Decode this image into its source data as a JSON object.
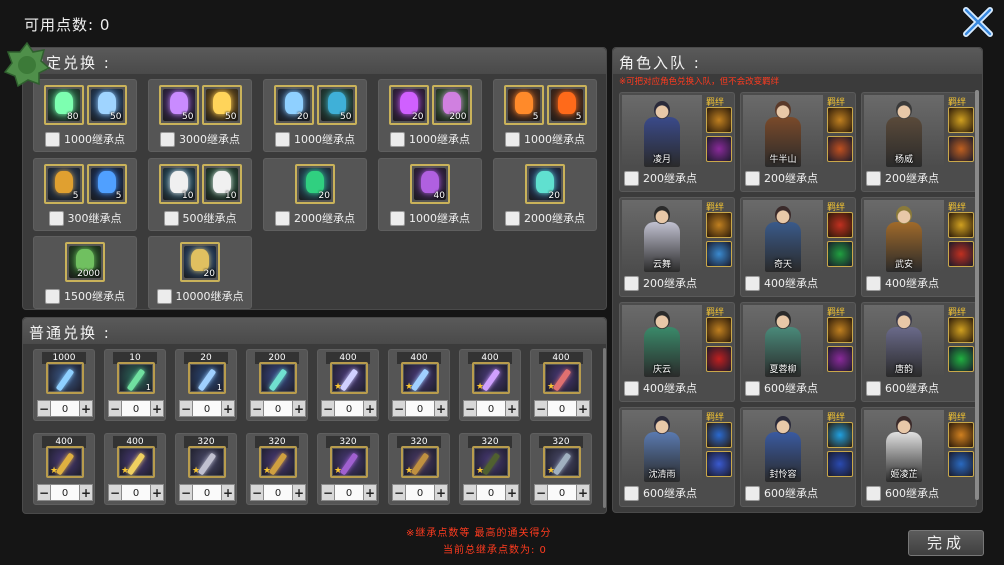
{
  "header": {
    "available_points": "可用点数: 0"
  },
  "limited": {
    "title": "限定兑换 :",
    "items": [
      {
        "cost": "1000继承点",
        "icons": [
          {
            "name": "green-gem-icon",
            "qty": "80",
            "color": "#2e8a5a",
            "shape": "#7dffb0"
          },
          {
            "name": "blue-gem-icon",
            "qty": "50",
            "color": "#2a5c9a",
            "shape": "#9fd4ff"
          }
        ]
      },
      {
        "cost": "3000继承点",
        "icons": [
          {
            "name": "purple-gem-icon",
            "qty": "50",
            "color": "#4c2f7a",
            "shape": "#c98bff"
          },
          {
            "name": "gold-gem-icon",
            "qty": "50",
            "color": "#9a6a1a",
            "shape": "#ffd45a"
          }
        ]
      },
      {
        "cost": "1000继承点",
        "icons": [
          {
            "name": "blue-crystal-icon",
            "qty": "20",
            "color": "#2d4d7a",
            "shape": "#8fd0ff"
          },
          {
            "name": "green-crystal-icon",
            "qty": "50",
            "color": "#2a6a5a",
            "shape": "#3fb0d8"
          }
        ]
      },
      {
        "cost": "1000继承点",
        "icons": [
          {
            "name": "purple-flame-icon",
            "qty": "20",
            "color": "#5a2a7a",
            "shape": "#d060ff"
          },
          {
            "name": "purple-powder-icon",
            "qty": "200",
            "color": "#4a8a4a",
            "shape": "#d080e0"
          }
        ]
      },
      {
        "cost": "1000继承点",
        "icons": [
          {
            "name": "fire-orb-icon",
            "qty": "5",
            "color": "#7a3a1a",
            "shape": "#ff8a2a"
          },
          {
            "name": "fire-orb-icon",
            "qty": "5",
            "color": "#7a3a1a",
            "shape": "#ff6a1a"
          }
        ]
      },
      {
        "cost": "300继承点",
        "icons": [
          {
            "name": "gold-scroll-icon",
            "qty": "5",
            "color": "#2a4a7a",
            "shape": "#e0a030"
          },
          {
            "name": "blue-scroll-icon",
            "qty": "5",
            "color": "#1a3a7a",
            "shape": "#50a0ff"
          }
        ]
      },
      {
        "cost": "500继承点",
        "icons": [
          {
            "name": "gourd-icon",
            "qty": "10",
            "color": "#2a6a8a",
            "shape": "#f0f0f0"
          },
          {
            "name": "gourd-icon",
            "qty": "10",
            "color": "#2a6a4a",
            "shape": "#f0f0f0"
          }
        ]
      },
      {
        "cost": "2000继承点",
        "icons": [
          {
            "name": "green-jade-icon",
            "qty": "20",
            "color": "#2a6a8a",
            "shape": "#30d080"
          }
        ]
      },
      {
        "cost": "1000继承点",
        "icons": [
          {
            "name": "purple-orb-icon",
            "qty": "40",
            "color": "#4a2a6a",
            "shape": "#b060e0"
          }
        ]
      },
      {
        "cost": "2000继承点",
        "icons": [
          {
            "name": "cyan-orb-icon",
            "qty": "20",
            "color": "#2a4a8a",
            "shape": "#60e0d0"
          }
        ]
      },
      {
        "cost": "1500继承点",
        "icons": [
          {
            "name": "green-frog-icon",
            "qty": "2000",
            "color": "#2a6a2a",
            "shape": "#70c060"
          }
        ]
      },
      {
        "cost": "10000继承点",
        "icons": [
          {
            "name": "sword-fragment-icon",
            "qty": "20",
            "color": "#2a5a9a",
            "shape": "#e0c060"
          }
        ]
      }
    ]
  },
  "normal": {
    "title": "普通兑换 :",
    "items": [
      {
        "price": "1000",
        "name": "blue-sword-icon",
        "bg": "#3a5a8a",
        "blade": "#8fd0ff",
        "star": false,
        "count": ""
      },
      {
        "price": "10",
        "name": "green-gem-icon",
        "bg": "#2a6a5a",
        "blade": "#70e0a0",
        "star": false,
        "count": "1"
      },
      {
        "price": "20",
        "name": "blue-gem-icon",
        "bg": "#2a4a7a",
        "blade": "#9fd0ff",
        "star": false,
        "count": "1"
      },
      {
        "price": "200",
        "name": "cyan-orb-icon",
        "bg": "#3a4a8a",
        "blade": "#70e0d0",
        "star": false,
        "count": ""
      },
      {
        "price": "400",
        "name": "purple-sword-icon",
        "bg": "#4a3a7a",
        "blade": "#d0d0ff",
        "star": true,
        "count": ""
      },
      {
        "price": "400",
        "name": "blue-spear-icon",
        "bg": "#4a3a7a",
        "blade": "#a0d0ff",
        "star": true,
        "count": ""
      },
      {
        "price": "400",
        "name": "purple-dagger-icon",
        "bg": "#4a3a7a",
        "blade": "#d0a0ff",
        "star": true,
        "count": ""
      },
      {
        "price": "400",
        "name": "red-axe-icon",
        "bg": "#4a3a7a",
        "blade": "#e07070",
        "star": true,
        "count": ""
      },
      {
        "price": "400",
        "name": "gold-bow-icon",
        "bg": "#4a3a7a",
        "blade": "#e0b040",
        "star": true,
        "count": ""
      },
      {
        "price": "400",
        "name": "gold-staff-icon",
        "bg": "#4a3a7a",
        "blade": "#f0d060",
        "star": true,
        "count": ""
      },
      {
        "price": "320",
        "name": "silver-armor-icon",
        "bg": "#4a4a6a",
        "blade": "#c0c0d0",
        "star": true,
        "count": ""
      },
      {
        "price": "320",
        "name": "gold-blade-icon",
        "bg": "#4a3a7a",
        "blade": "#d0a040",
        "star": true,
        "count": ""
      },
      {
        "price": "320",
        "name": "purple-glove-icon",
        "bg": "#4a3a7a",
        "blade": "#a060d0",
        "star": true,
        "count": ""
      },
      {
        "price": "320",
        "name": "gold-armor-icon",
        "bg": "#4a3a6a",
        "blade": "#c09040",
        "star": true,
        "count": ""
      },
      {
        "price": "320",
        "name": "dark-robe-icon",
        "bg": "#4a3a7a",
        "blade": "#506030",
        "star": true,
        "count": ""
      },
      {
        "price": "320",
        "name": "steel-armor-icon",
        "bg": "#4a4a6a",
        "blade": "#a0b0c0",
        "star": true,
        "count": ""
      }
    ],
    "stepper_value": "0",
    "minus": "−",
    "plus": "+"
  },
  "team": {
    "title": "角色入队 :",
    "note": "※可把对应角色兑换入队，但不会改变羁绊",
    "bond_label": "羁绊",
    "characters": [
      {
        "name": "凌月",
        "cost": "200继承点",
        "hair": "#2a2a3a",
        "robe": "#3a4a8a",
        "s1": "#c08020",
        "s2": "#8a2a9a"
      },
      {
        "name": "牛半山",
        "cost": "200继承点",
        "hair": "#5a3a2a",
        "robe": "#7a4a2a",
        "s1": "#c08020",
        "s2": "#c05020"
      },
      {
        "name": "杨威",
        "cost": "200继承点",
        "hair": "#3a3a3a",
        "robe": "#5a4a3a",
        "s1": "#d0a020",
        "s2": "#c06020"
      },
      {
        "name": "云舞",
        "cost": "200继承点",
        "hair": "#2a2a2a",
        "robe": "#c0c0d0",
        "s1": "#c08020",
        "s2": "#3a8ad0"
      },
      {
        "name": "奇天",
        "cost": "400继承点",
        "hair": "#3a2a2a",
        "robe": "#3a5a8a",
        "s1": "#c03020",
        "s2": "#20a040"
      },
      {
        "name": "武安",
        "cost": "400继承点",
        "hair": "#8a7a3a",
        "robe": "#a06a2a",
        "s1": "#d0a020",
        "s2": "#c03020"
      },
      {
        "name": "庆云",
        "cost": "400继承点",
        "hair": "#2a2a2a",
        "robe": "#3a8a6a",
        "s1": "#c08020",
        "s2": "#c02020"
      },
      {
        "name": "夏蓉柳",
        "cost": "600继承点",
        "hair": "#2a2a2a",
        "robe": "#4a8a7a",
        "s1": "#c08020",
        "s2": "#8a2a9a"
      },
      {
        "name": "唐韵",
        "cost": "600继承点",
        "hair": "#3a3a4a",
        "robe": "#6a6a8a",
        "s1": "#d0a020",
        "s2": "#20b040"
      },
      {
        "name": "沈清雨",
        "cost": "600继承点",
        "hair": "#2a2a3a",
        "robe": "#5a7ab0",
        "s1": "#2a6ad0",
        "s2": "#3a5ad0"
      },
      {
        "name": "封怜容",
        "cost": "600继承点",
        "hair": "#2a2a3a",
        "robe": "#3a5aa0",
        "s1": "#20a0e0",
        "s2": "#2a4ab0"
      },
      {
        "name": "姬凌芷",
        "cost": "600继承点",
        "hair": "#3a2a2a",
        "robe": "#e0e0e0",
        "s1": "#d08020",
        "s2": "#2a6ac0"
      }
    ]
  },
  "footer": {
    "note1": "※继承点数等 最高的通关得分",
    "note2": "当前总继承点数为: 0",
    "done": "完成"
  },
  "colors": {
    "accent_red": "#ff3b1f",
    "bond_gold": "#f1c232",
    "frame_gold": "#c9b25a"
  }
}
